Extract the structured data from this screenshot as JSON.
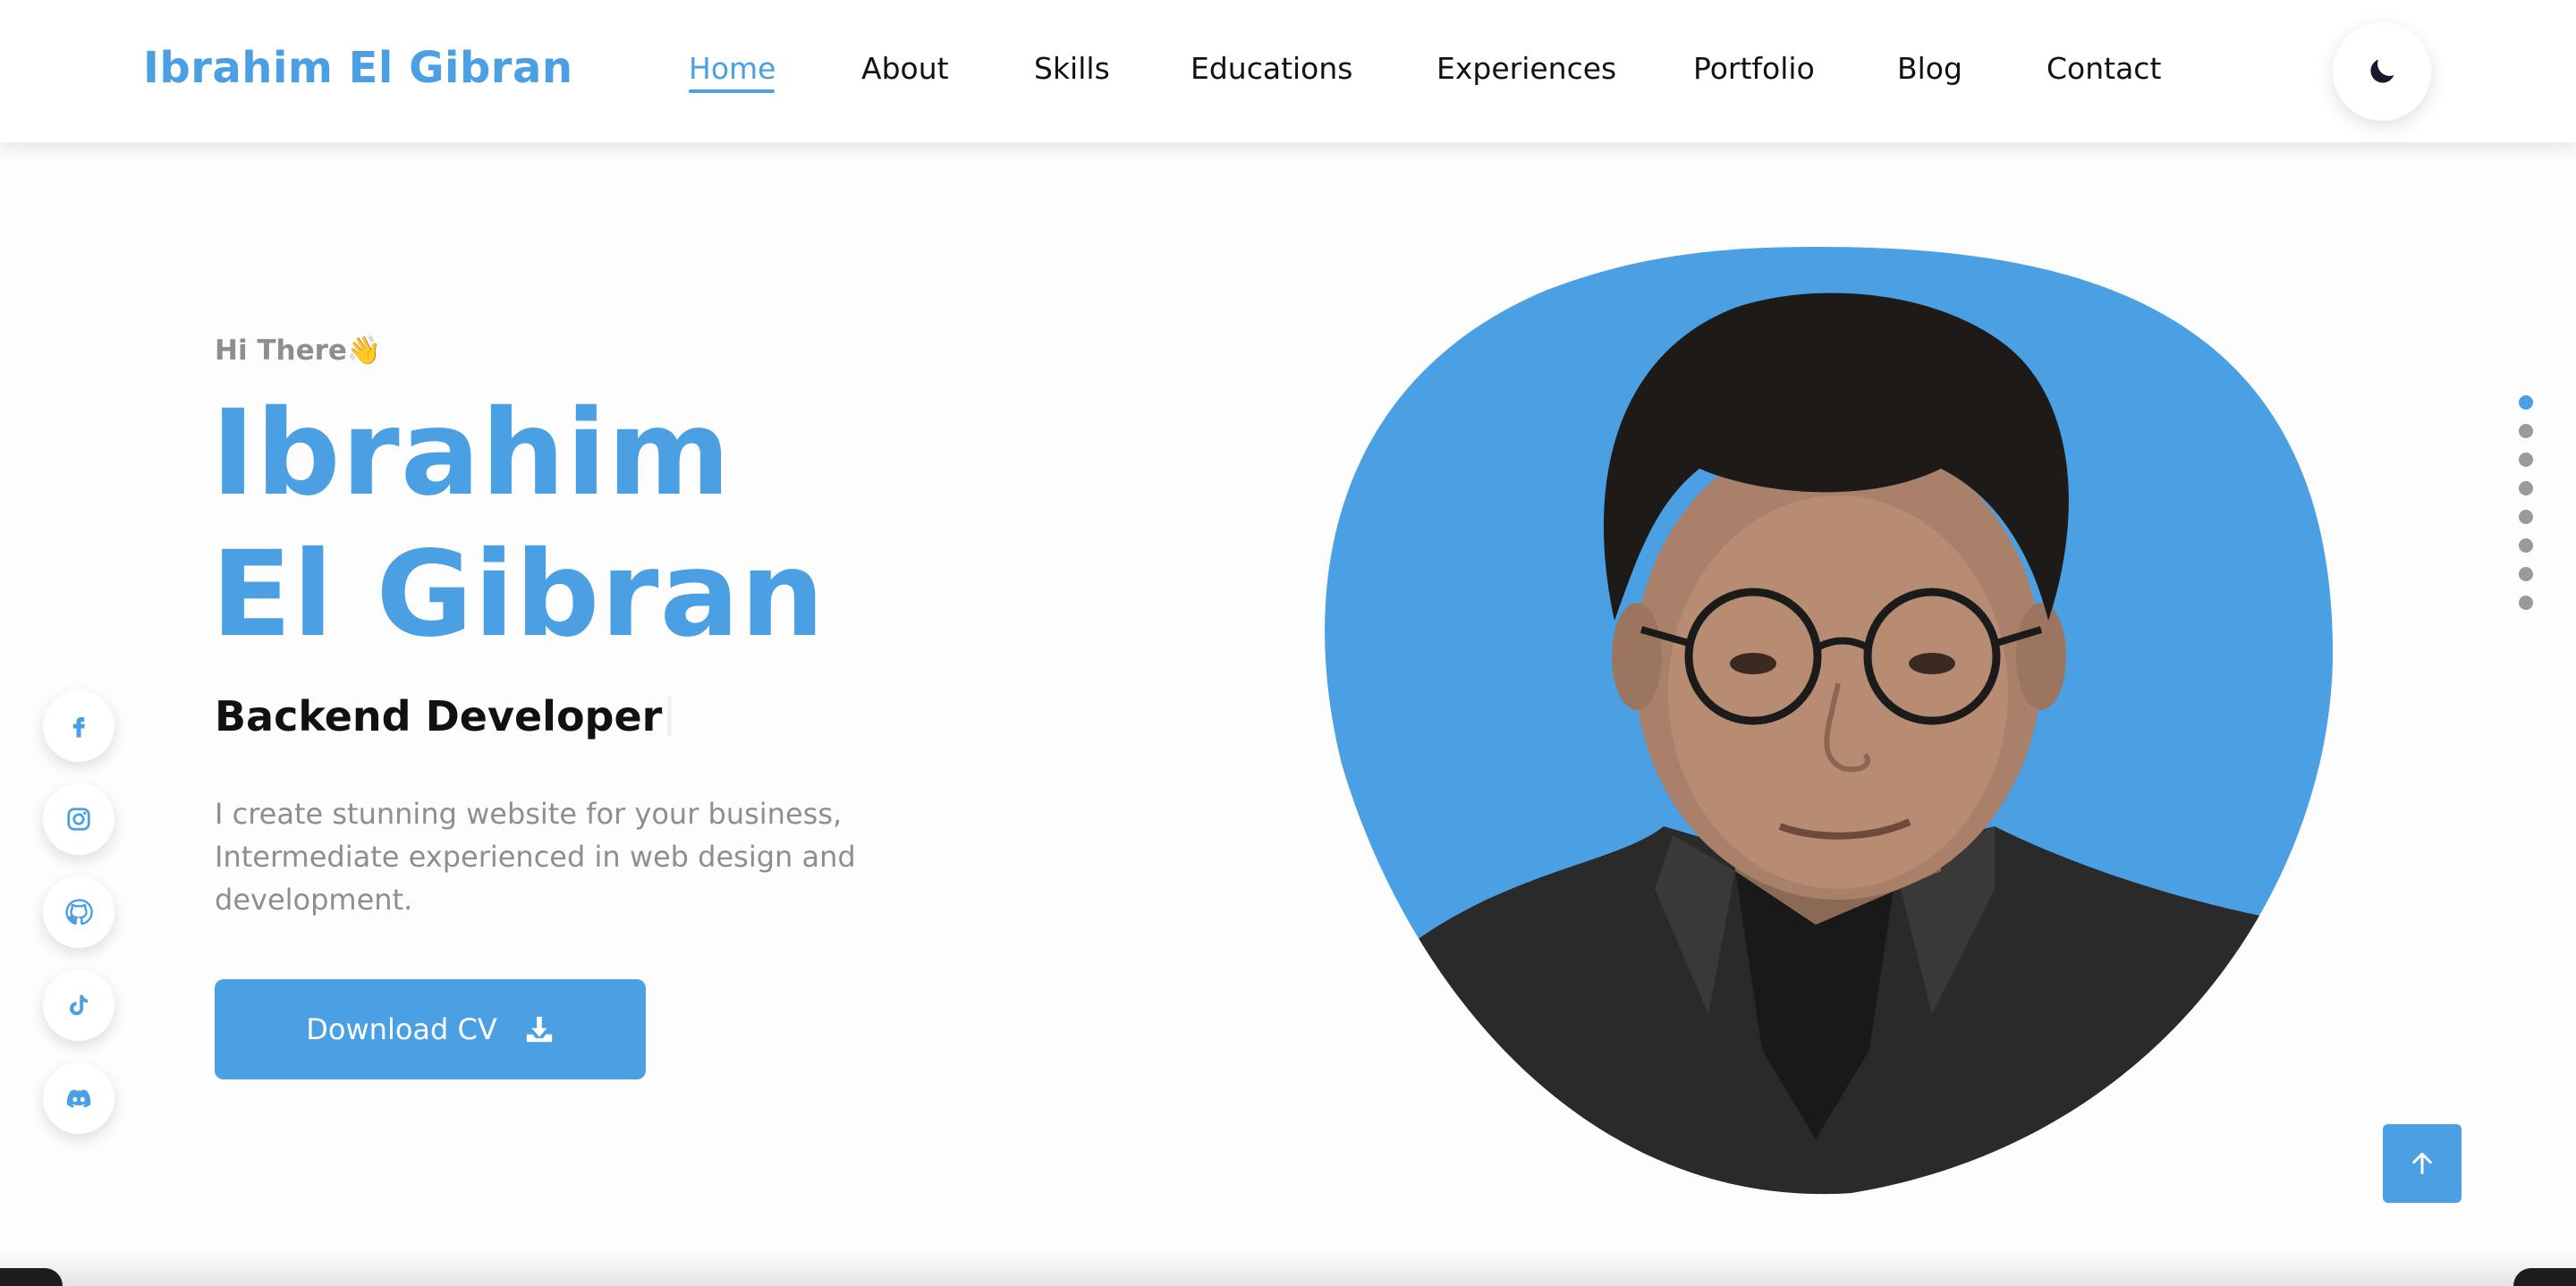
{
  "brand": {
    "name": "Ibrahim El Gibran"
  },
  "nav": {
    "items": [
      {
        "label": "Home",
        "active": true
      },
      {
        "label": "About",
        "active": false
      },
      {
        "label": "Skills",
        "active": false
      },
      {
        "label": "Educations",
        "active": false
      },
      {
        "label": "Experiences",
        "active": false
      },
      {
        "label": "Portfolio",
        "active": false
      },
      {
        "label": "Blog",
        "active": false
      },
      {
        "label": "Contact",
        "active": false
      }
    ],
    "theme_toggle_icon": "moon-icon"
  },
  "hero": {
    "greeting": "Hi There",
    "greeting_emoji": "👋",
    "name": "Ibrahim El Gibran",
    "role": "Backend Developer",
    "description": "I create stunning website for your business, Intermediate experienced in web design and development.",
    "cv_button_label": "Download CV",
    "cv_button_icon": "download-icon"
  },
  "social": [
    {
      "name": "facebook",
      "icon": "facebook-icon"
    },
    {
      "name": "instagram",
      "icon": "instagram-icon"
    },
    {
      "name": "github",
      "icon": "github-icon"
    },
    {
      "name": "tiktok",
      "icon": "tiktok-icon"
    },
    {
      "name": "discord",
      "icon": "discord-icon"
    }
  ],
  "section_dots": {
    "count": 8,
    "active_index": 0
  },
  "scroll_top_icon": "arrow-up-icon",
  "colors": {
    "accent": "#4aa0e2",
    "text": "#111111",
    "muted": "#8e8e8e"
  }
}
